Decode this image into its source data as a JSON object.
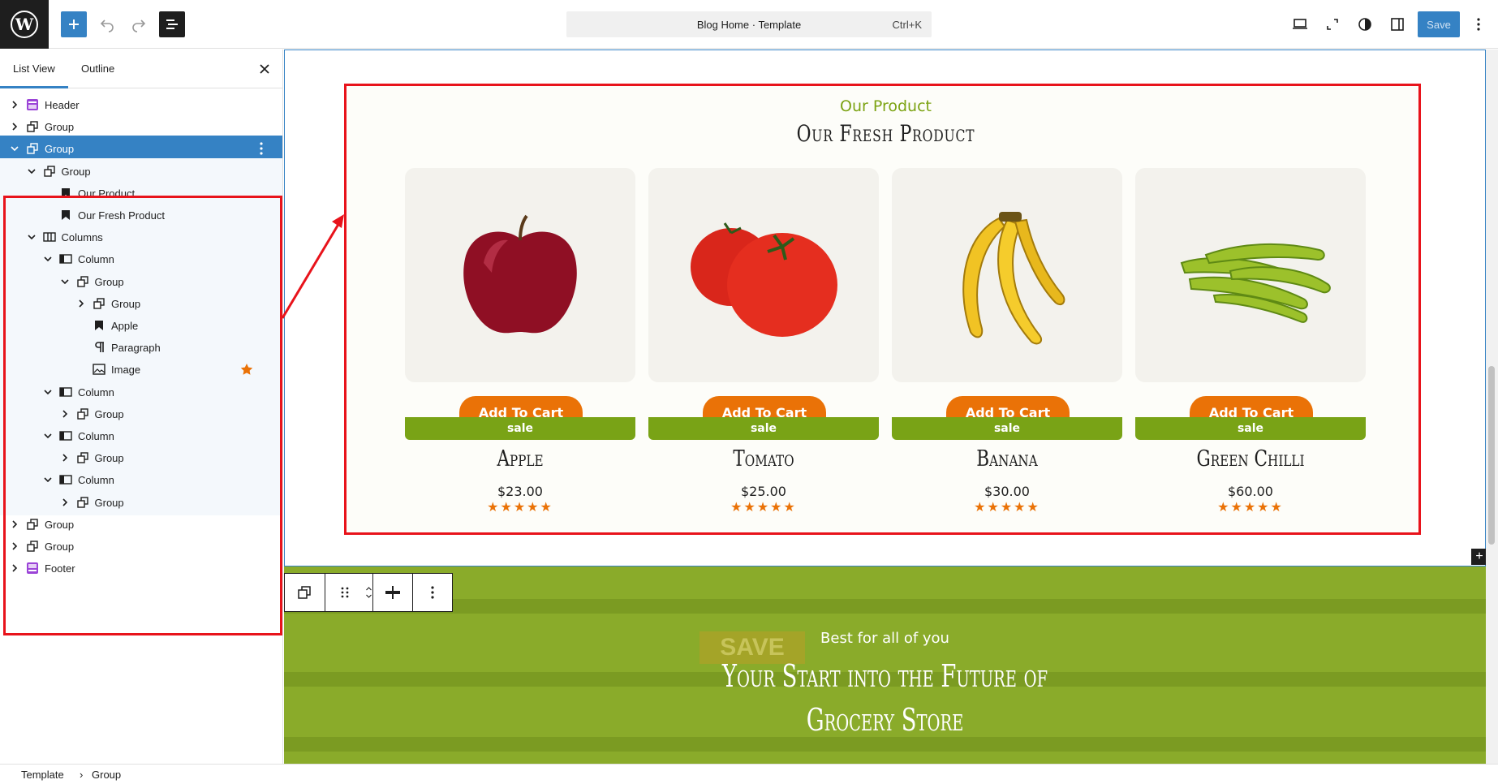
{
  "toolbar": {
    "command_title": "Blog Home · Template",
    "command_shortcut": "Ctrl+K",
    "save_label": "Save"
  },
  "sidebar": {
    "tabs": [
      "List View",
      "Outline"
    ],
    "active_tab": "List View",
    "items": [
      {
        "label": "Header",
        "icon": "template-part-header-icon",
        "expanded": false
      },
      {
        "label": "Group",
        "icon": "group-icon",
        "expanded": false
      },
      {
        "label": "Group",
        "icon": "group-icon",
        "expanded": true,
        "selected": true
      },
      {
        "label": "Group",
        "icon": "group-icon",
        "expanded": true
      },
      {
        "label": "Our Product",
        "icon": "heading-bookmark-icon"
      },
      {
        "label": "Our Fresh Product",
        "icon": "heading-bookmark-icon"
      },
      {
        "label": "Columns",
        "icon": "columns-icon",
        "expanded": true
      },
      {
        "label": "Column",
        "icon": "column-icon",
        "expanded": true
      },
      {
        "label": "Group",
        "icon": "group-icon",
        "expanded": true
      },
      {
        "label": "Group",
        "icon": "group-icon",
        "expanded": false
      },
      {
        "label": "Apple",
        "icon": "heading-bookmark-icon"
      },
      {
        "label": "Paragraph",
        "icon": "paragraph-icon"
      },
      {
        "label": "Image",
        "icon": "image-icon"
      },
      {
        "label": "Column",
        "icon": "column-icon",
        "expanded": true
      },
      {
        "label": "Group",
        "icon": "group-icon",
        "expanded": false
      },
      {
        "label": "Column",
        "icon": "column-icon",
        "expanded": true
      },
      {
        "label": "Group",
        "icon": "group-icon",
        "expanded": false
      },
      {
        "label": "Column",
        "icon": "column-icon",
        "expanded": true
      },
      {
        "label": "Group",
        "icon": "group-icon",
        "expanded": false
      },
      {
        "label": "Group",
        "icon": "group-icon",
        "expanded": false
      },
      {
        "label": "Group",
        "icon": "group-icon",
        "expanded": false
      },
      {
        "label": "Footer",
        "icon": "template-part-footer-icon",
        "expanded": false
      }
    ]
  },
  "breadcrumb": [
    "Template",
    "Group"
  ],
  "section_products": {
    "eyebrow": "Our Product",
    "heading": "Our Fresh Product",
    "products": [
      {
        "name": "Apple",
        "price": "$23.00",
        "button": "Add To Cart",
        "badge": "sale",
        "rating": 5,
        "stars": "★★★★★"
      },
      {
        "name": "Tomato",
        "price": "$25.00",
        "button": "Add To Cart",
        "badge": "sale",
        "rating": 5,
        "stars": "★★★★★"
      },
      {
        "name": "Banana",
        "price": "$30.00",
        "button": "Add To Cart",
        "badge": "sale",
        "rating": 5,
        "stars": "★★★★★"
      },
      {
        "name": "Green Chilli",
        "price": "$60.00",
        "button": "Add To Cart",
        "badge": "sale",
        "rating": 5,
        "stars": "★★★★★"
      }
    ]
  },
  "section_banner": {
    "eyebrow": "Best for all of you",
    "title_line1": "Your Start into the Future of",
    "title_line2": "Grocery Store",
    "sign_text": "SAVE"
  },
  "colors": {
    "accent": "#3582c4",
    "highlight_box": "#e8131b",
    "brand_orange": "#ea7207",
    "brand_green": "#79a316"
  }
}
